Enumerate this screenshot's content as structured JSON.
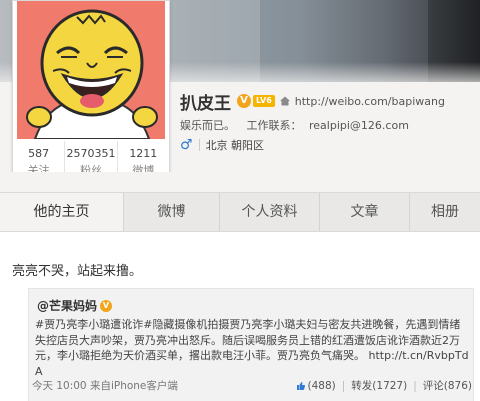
{
  "profile": {
    "name": "扒皮王",
    "home_url": "http://weibo.com/bapiwang",
    "tagline": "娱乐而已。",
    "contact_label": "工作联系：",
    "email": "realpipi@126.com",
    "location": "北京 朝阳区",
    "vip_label": "LV6"
  },
  "stats": [
    {
      "num": "587",
      "label": "关注"
    },
    {
      "num": "2570351",
      "label": "粉丝"
    },
    {
      "num": "1211",
      "label": "微博"
    }
  ],
  "tabs": [
    {
      "label": "他的主页"
    },
    {
      "label": "微博"
    },
    {
      "label": "个人资料"
    },
    {
      "label": "文章"
    },
    {
      "label": "相册"
    }
  ],
  "post": {
    "text": "亮亮不哭，站起来撸。",
    "repost": {
      "author": "@芒果妈妈",
      "body_tag": "#贾乃亮李小璐遭讹诈#",
      "body_text": "隐藏摄像机拍摄贾乃亮李小璐夫妇与密友共进晚餐，先遇到情绪失控店员大声吵架，贾乃亮冲出怒斥。随后误喝服务员上错的红酒遭饭店讹诈酒款近2万元，李小璐拒绝为天价酒买单，撂出款电汪小菲。贾乃亮负气痛哭。",
      "body_link": "http://t.cn/RvbpTdA"
    },
    "time": "今天 10:00",
    "source": "来自iPhone客户端",
    "likes": "(488)",
    "forward": "转发(1727)",
    "comment": "评论(876)"
  },
  "colors": {
    "accent_blue": "#2d7bd4",
    "avatar_bg": "#f07a6c",
    "badge_orange": "#f2a51a"
  }
}
